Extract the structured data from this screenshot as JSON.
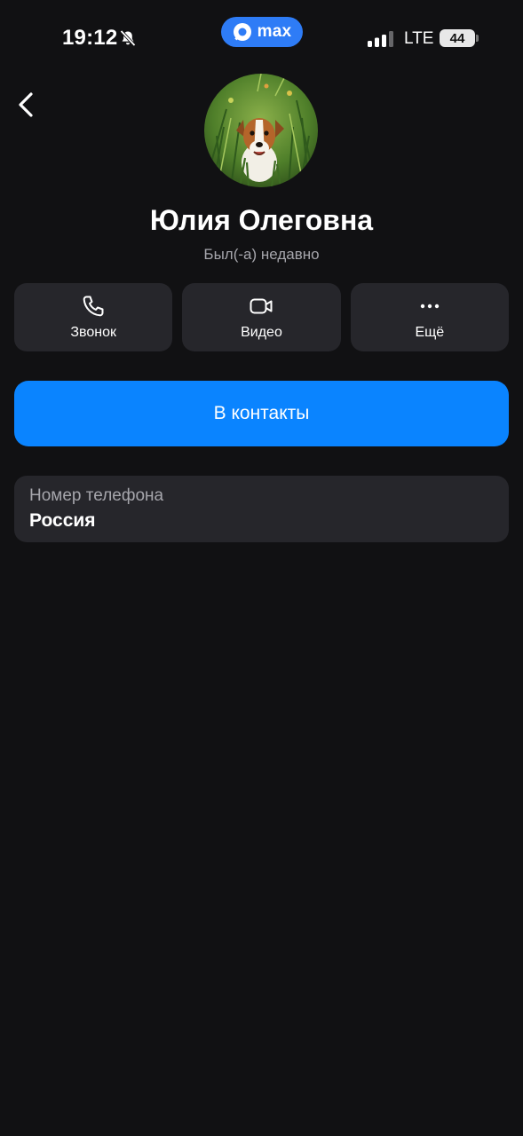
{
  "status_bar": {
    "time": "19:12",
    "network": "LTE",
    "battery": "44",
    "app_badge": "max",
    "icons": [
      "bell-off-icon",
      "signal-icon"
    ]
  },
  "profile": {
    "name": "Юлия Олеговна",
    "last_seen": "Был(-а) недавно",
    "avatar": "dog-photo"
  },
  "actions": [
    {
      "label": "Звонок",
      "icon": "phone-icon"
    },
    {
      "label": "Видео",
      "icon": "video-camera-icon"
    },
    {
      "label": "Ещё",
      "icon": "more-icon"
    }
  ],
  "add_contact": {
    "label": "В контакты"
  },
  "info": {
    "label": "Номер телефона",
    "value": "Россия"
  },
  "colors": {
    "background": "#111113",
    "card": "#26262b",
    "accent": "#0a84ff",
    "pill": "#2e7cf6",
    "muted_text": "#a6a6ac"
  }
}
